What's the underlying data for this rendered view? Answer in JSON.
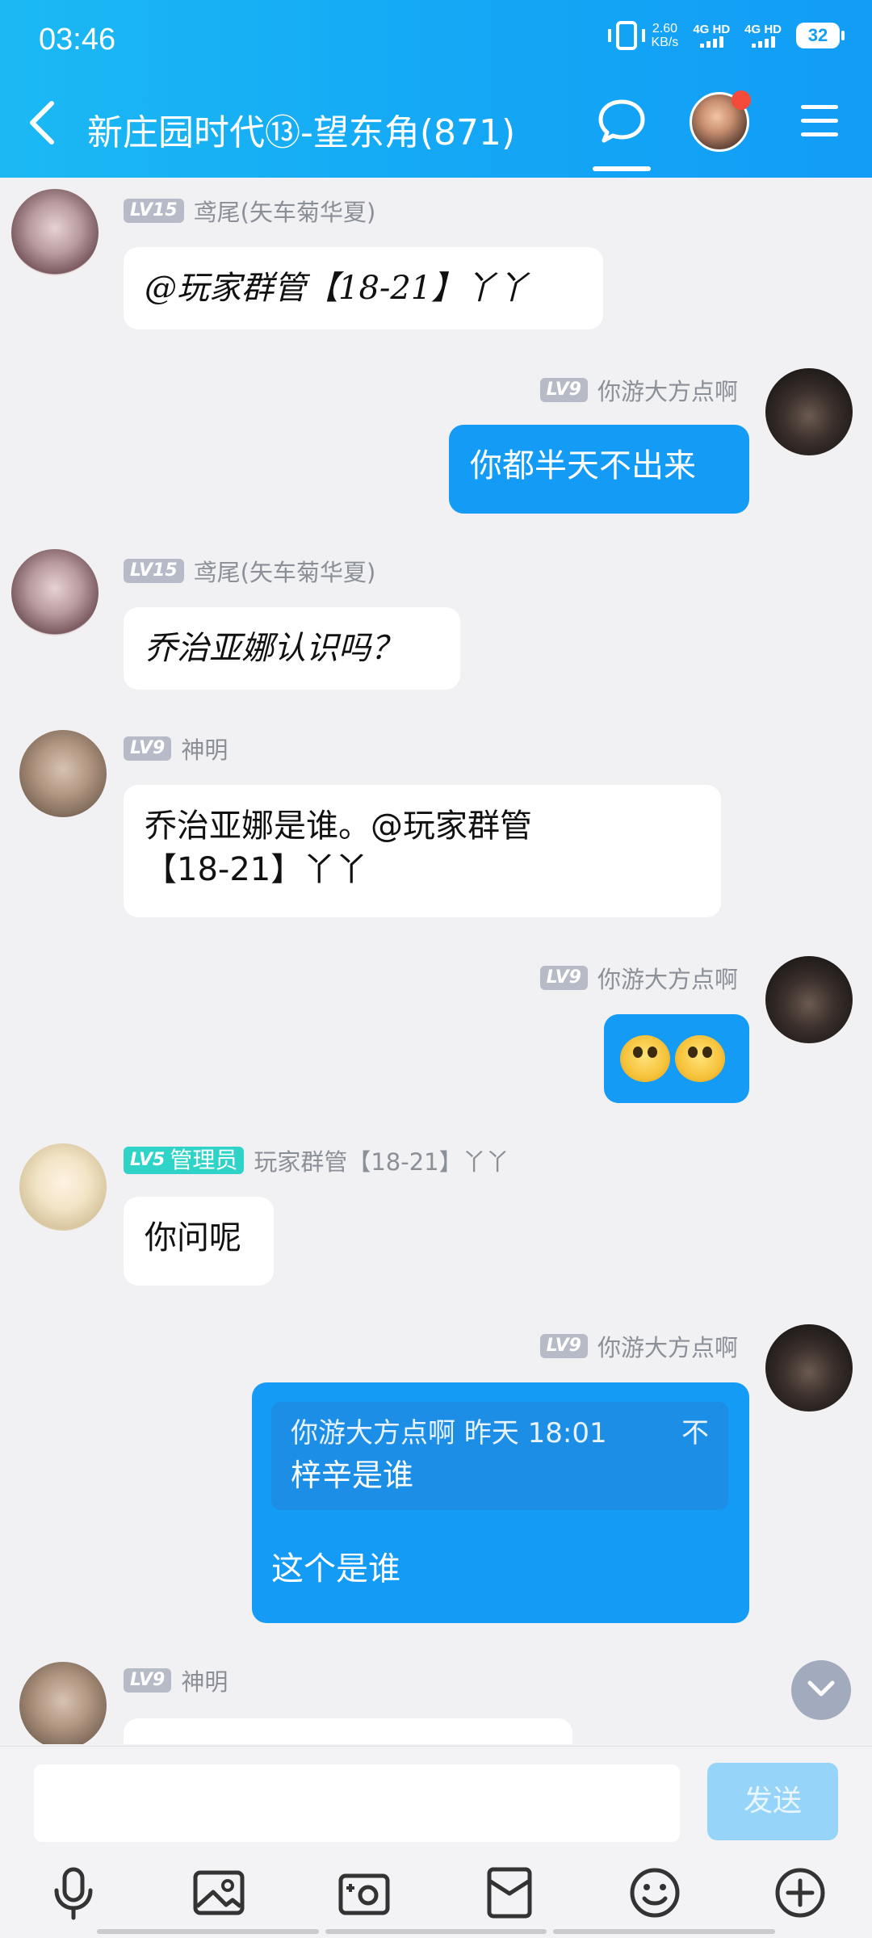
{
  "status_bar": {
    "time": "03:46",
    "net_speed_value": "2.60",
    "net_speed_unit": "KB/s",
    "sim1": "4G HD",
    "sim2": "4G HD",
    "battery": "32"
  },
  "header": {
    "title": "新庄园时代⑬-望东角(871)"
  },
  "messages": [
    {
      "sender": "鸢尾(矢车菊华夏)",
      "level": "LV15",
      "side": "left",
      "text": "@玩家群管【18-21】丫丫"
    },
    {
      "sender": "你游大方点啊",
      "level": "LV9",
      "side": "right",
      "text": "你都半天不出来"
    },
    {
      "sender": "鸢尾(矢车菊华夏)",
      "level": "LV15",
      "side": "left",
      "text": "乔治亚娜认识吗？"
    },
    {
      "sender": "神明",
      "level": "LV9",
      "side": "left",
      "text_line1": "乔治亚娜是谁。@玩家群管",
      "text_line2": "【18-21】丫丫"
    },
    {
      "sender": "你游大方点啊",
      "level": "LV9",
      "side": "right",
      "emojis": [
        "smile-emoji",
        "smile-emoji"
      ]
    },
    {
      "sender": "玩家群管【18-21】丫丫",
      "level": "LV5",
      "badge": "管理员",
      "side": "left",
      "text": "你问呢"
    },
    {
      "sender": "你游大方点啊",
      "level": "LV9",
      "side": "right",
      "quote": {
        "author": "你游大方点啊",
        "time": "昨天 18:01",
        "extra": "不",
        "text": "梓辛是谁"
      },
      "text": "这个是谁"
    },
    {
      "sender": "神明",
      "level": "LV9",
      "side": "left"
    }
  ],
  "input": {
    "placeholder": "",
    "send_label": "发送"
  },
  "toolbar": [
    "microphone-icon",
    "image-icon",
    "camera-icon",
    "red-packet-icon",
    "emoji-icon",
    "plus-icon"
  ],
  "colors": {
    "header": "#139ff6",
    "my_bubble": "#139bf6",
    "admin_badge": "#2fd3c8",
    "level_badge": "#b6bbc7"
  }
}
